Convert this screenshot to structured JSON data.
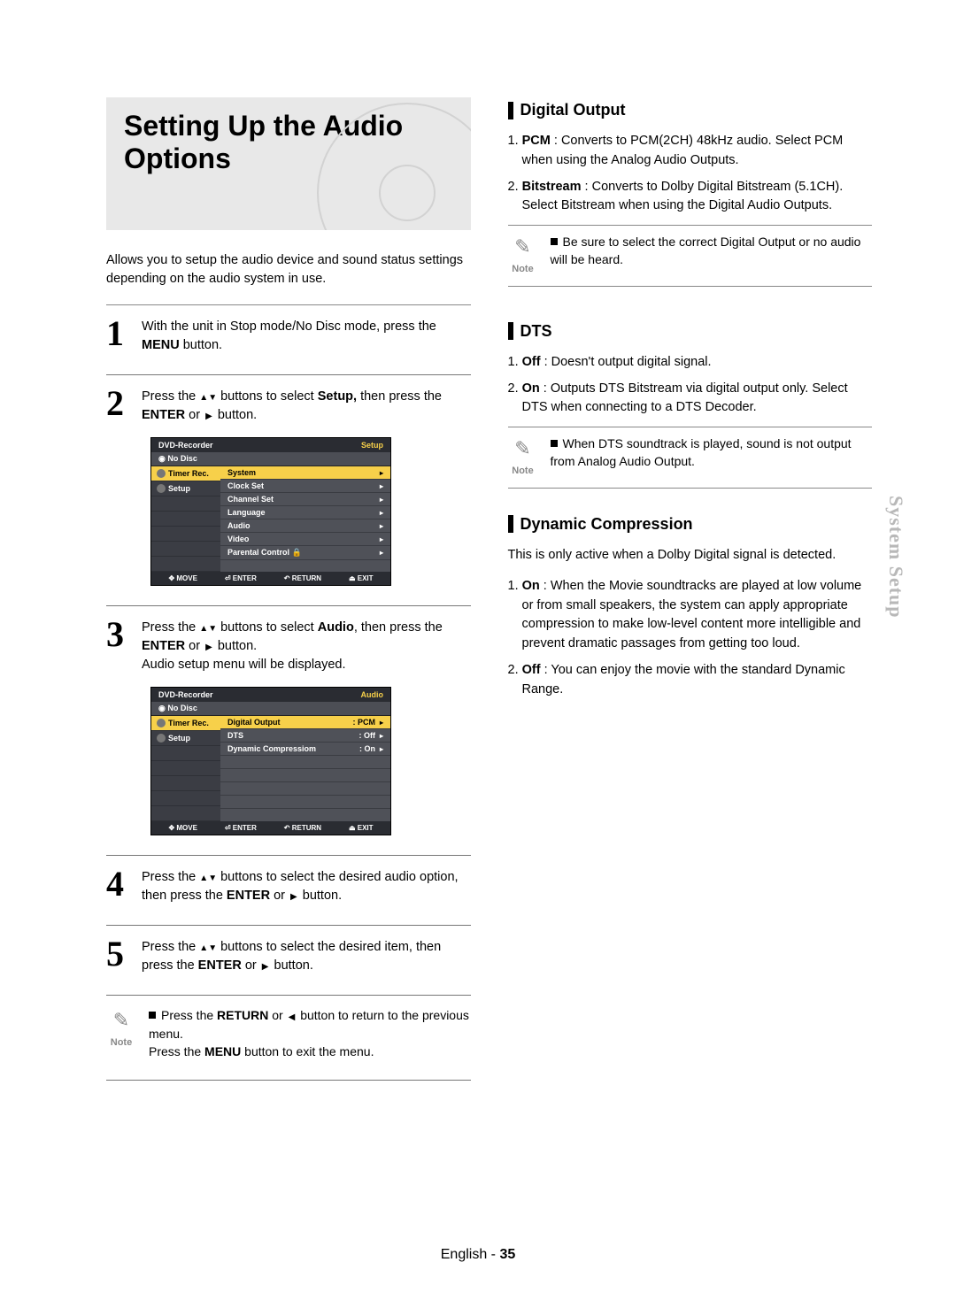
{
  "title": "Setting Up the Audio Options",
  "intro": "Allows you to setup the audio device and sound status settings depending on the audio system in use.",
  "steps": {
    "s1": {
      "num": "1",
      "text_pre": "With the unit in Stop mode/No Disc mode, press the ",
      "bold1": "MENU",
      "text_post": " button."
    },
    "s2": {
      "num": "2",
      "text_pre": "Press the ",
      "text_mid": " buttons to select ",
      "bold1": "Setup,",
      "text_mid2": " then press the ",
      "bold2": "ENTER",
      "text_post": " or ",
      "text_end": " button."
    },
    "s3": {
      "num": "3",
      "text_pre": "Press the ",
      "text_mid": " buttons to select ",
      "bold1": "Audio",
      "text_mid2": ", then press the  ",
      "bold2": "ENTER",
      "text_post": " or ",
      "text_end": " button.",
      "extra": "Audio setup menu will be displayed."
    },
    "s4": {
      "num": "4",
      "text_pre": "Press the ",
      "text_mid": " buttons to select the desired audio option, then press the ",
      "bold1": "ENTER",
      "text_post": " or ",
      "text_end": " button."
    },
    "s5": {
      "num": "5",
      "text_pre": "Press the ",
      "text_mid": " buttons to select the desired item, then press the ",
      "bold1": "ENTER",
      "text_post": " or ",
      "text_end": " button."
    }
  },
  "note_left": {
    "label": "Note",
    "line1_pre": "Press the ",
    "line1_b": "RETURN",
    "line1_mid": " or ",
    "line1_post": " button to return to the previous menu.",
    "line2_pre": "Press the ",
    "line2_b": "MENU",
    "line2_post": " button to exit the menu."
  },
  "screen1": {
    "title_l": "DVD-Recorder",
    "title_r": "Setup",
    "sub": "No Disc",
    "left": [
      "Timer Rec.",
      "Setup"
    ],
    "right": [
      {
        "label": "System",
        "sel": true
      },
      {
        "label": "Clock Set"
      },
      {
        "label": "Channel Set"
      },
      {
        "label": "Language"
      },
      {
        "label": "Audio"
      },
      {
        "label": "Video"
      },
      {
        "label": "Parental Control",
        "lock": true
      }
    ],
    "foot": [
      "MOVE",
      "ENTER",
      "RETURN",
      "EXIT"
    ],
    "foot_icons": [
      "✥",
      "⏎",
      "↶",
      "⏏"
    ]
  },
  "screen2": {
    "title_l": "DVD-Recorder",
    "title_r": "Audio",
    "sub": "No Disc",
    "left": [
      "Timer Rec.",
      "Setup"
    ],
    "right": [
      {
        "label": "Digital Output",
        "val": ": PCM",
        "sel": true
      },
      {
        "label": "DTS",
        "val": ": Off"
      },
      {
        "label": "Dynamic Compressiom",
        "val": ": On"
      }
    ],
    "foot": [
      "MOVE",
      "ENTER",
      "RETURN",
      "EXIT"
    ],
    "foot_icons": [
      "✥",
      "⏎",
      "↶",
      "⏏"
    ]
  },
  "sections": {
    "digital_output": {
      "title": "Digital Output",
      "items": [
        {
          "n": "1.",
          "b": "PCM",
          "t": " : Converts to PCM(2CH) 48kHz audio. Select PCM when using the Analog Audio Outputs."
        },
        {
          "n": "2.",
          "b": "Bitstream",
          "t": " : Converts to Dolby Digital Bitstream (5.1CH). Select Bitstream when using the Digital Audio Outputs."
        }
      ],
      "note": {
        "label": "Note",
        "text": "Be sure to select the correct Digital Output or no audio will be heard."
      }
    },
    "dts": {
      "title": "DTS",
      "items": [
        {
          "n": "1.",
          "b": "Off",
          "t": " : Doesn't output digital signal."
        },
        {
          "n": "2.",
          "b": "On",
          "t": " : Outputs DTS Bitstream via digital output only. Select DTS when connecting to a DTS Decoder."
        }
      ],
      "note": {
        "label": "Note",
        "text": "When DTS soundtrack is played, sound is not output from Analog Audio Output."
      }
    },
    "dynamic": {
      "title": "Dynamic Compression",
      "intro": "This is only active when a Dolby Digital signal is detected.",
      "items": [
        {
          "n": "1.",
          "b": "On",
          "t": " : When the Movie soundtracks are played at low volume or from small speakers, the system can apply appropriate compression to make low-level content more intelligible and prevent dramatic passages from getting too loud."
        },
        {
          "n": "2.",
          "b": "Off",
          "t": " : You can enjoy the movie with the standard Dynamic Range."
        }
      ]
    }
  },
  "side_tab": "System Setup",
  "footer": {
    "lang": "English",
    "sep": " - ",
    "page": "35"
  }
}
